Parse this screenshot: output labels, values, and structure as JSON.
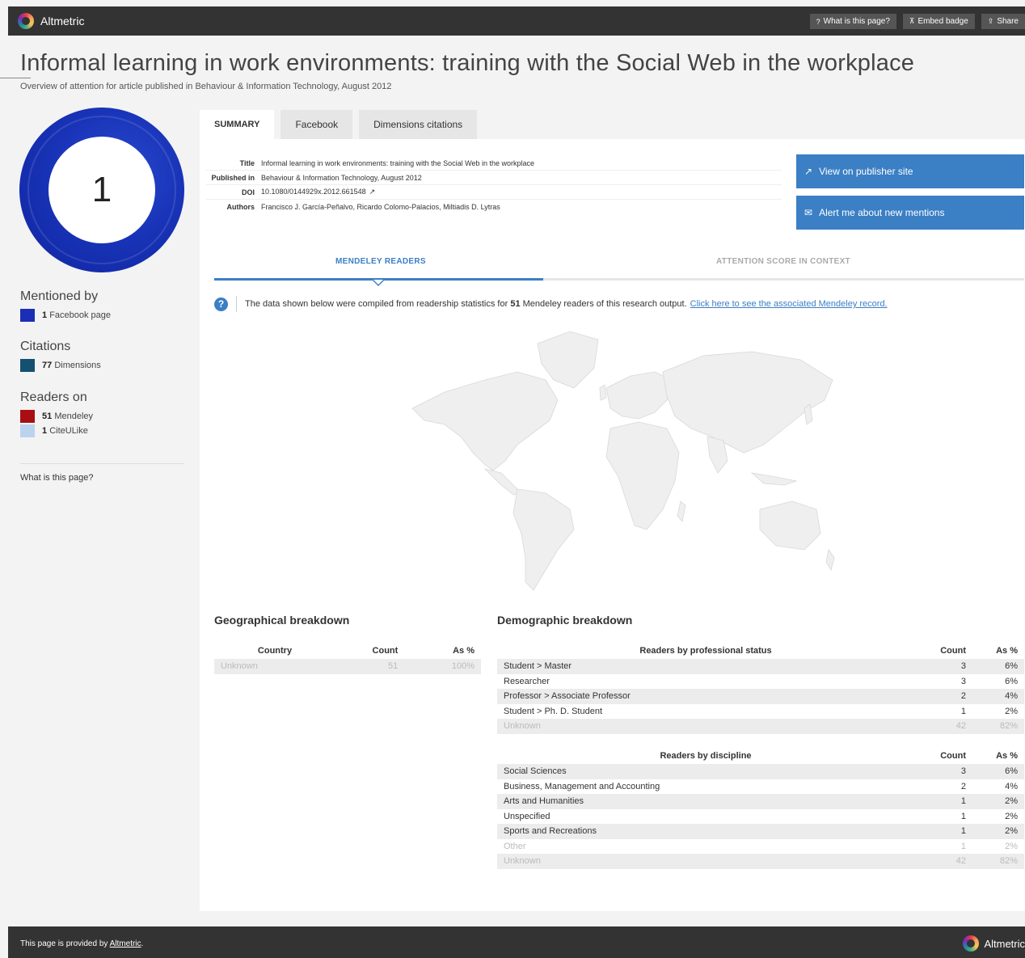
{
  "header": {
    "brand": "Altmetric",
    "actions": [
      {
        "icon": "question-icon",
        "glyph": "?",
        "label": "What is this page?"
      },
      {
        "icon": "pin-icon",
        "glyph": "⊼",
        "label": "Embed badge"
      },
      {
        "icon": "share-icon",
        "glyph": "⇪",
        "label": "Share"
      }
    ]
  },
  "article": {
    "title": "Informal learning in work environments: training with the Social Web in the workplace",
    "subtitle": "Overview of attention for article published in Behaviour & Information Technology, August 2012"
  },
  "score": {
    "value": "1",
    "color": "#1934b8"
  },
  "sidebar": {
    "mentioned_heading": "Mentioned by",
    "mentioned": [
      {
        "count": "1",
        "label": "Facebook page",
        "color": "#1a2fb5"
      }
    ],
    "citations_heading": "Citations",
    "citations": [
      {
        "count": "77",
        "label": "Dimensions",
        "color": "#145070"
      }
    ],
    "readers_heading": "Readers on",
    "readers": [
      {
        "count": "51",
        "label": "Mendeley",
        "color": "#a80f13"
      },
      {
        "count": "1",
        "label": "CiteULike",
        "color": "#bcd3ee"
      }
    ],
    "what_link": "What is this page?"
  },
  "tabs": [
    "SUMMARY",
    "Facebook",
    "Dimensions citations"
  ],
  "summary": {
    "title_label": "Title",
    "title_value": "Informal learning in work environments: training with the Social Web in the workplace",
    "published_label": "Published in",
    "published_value": "Behaviour & Information Technology, August 2012",
    "doi_label": "DOI",
    "doi_value": "10.1080/0144929x.2012.661548",
    "authors_label": "Authors",
    "authors_value": "Francisco J. García-Peñalvo, Ricardo Colomo-Palacios, Miltiadis D. Lytras"
  },
  "buttons": {
    "publisher": "View on publisher site",
    "alert": "Alert me about new mentions"
  },
  "subtabs": {
    "mendeley": "MENDELEY READERS",
    "context": "ATTENTION SCORE IN CONTEXT"
  },
  "info": {
    "prefix": "The data shown below were compiled from readership statistics for",
    "count": "51",
    "suffix": "Mendeley readers of this research output.",
    "link": "Click here to see the associated Mendeley record."
  },
  "geo": {
    "title": "Geographical breakdown",
    "headers": [
      "Country",
      "Count",
      "As %"
    ],
    "rows": [
      [
        "Unknown",
        "51",
        "100%"
      ]
    ]
  },
  "demo": {
    "title": "Demographic breakdown",
    "status_headers": [
      "Readers by professional status",
      "Count",
      "As %"
    ],
    "status_rows": [
      [
        "Student > Master",
        "3",
        "6%"
      ],
      [
        "Researcher",
        "3",
        "6%"
      ],
      [
        "Professor > Associate Professor",
        "2",
        "4%"
      ],
      [
        "Student > Ph. D. Student",
        "1",
        "2%"
      ],
      [
        "Unknown",
        "42",
        "82%"
      ]
    ],
    "discipline_headers": [
      "Readers by discipline",
      "Count",
      "As %"
    ],
    "discipline_rows": [
      [
        "Social Sciences",
        "3",
        "6%"
      ],
      [
        "Business, Management and Accounting",
        "2",
        "4%"
      ],
      [
        "Arts and Humanities",
        "1",
        "2%"
      ],
      [
        "Unspecified",
        "1",
        "2%"
      ],
      [
        "Sports and Recreations",
        "1",
        "2%"
      ],
      [
        "Other",
        "1",
        "2%"
      ],
      [
        "Unknown",
        "42",
        "82%"
      ]
    ]
  },
  "footer": {
    "text": "This page is provided by",
    "link": "Altmetric",
    "end": ".",
    "brand": "Altmetric"
  }
}
